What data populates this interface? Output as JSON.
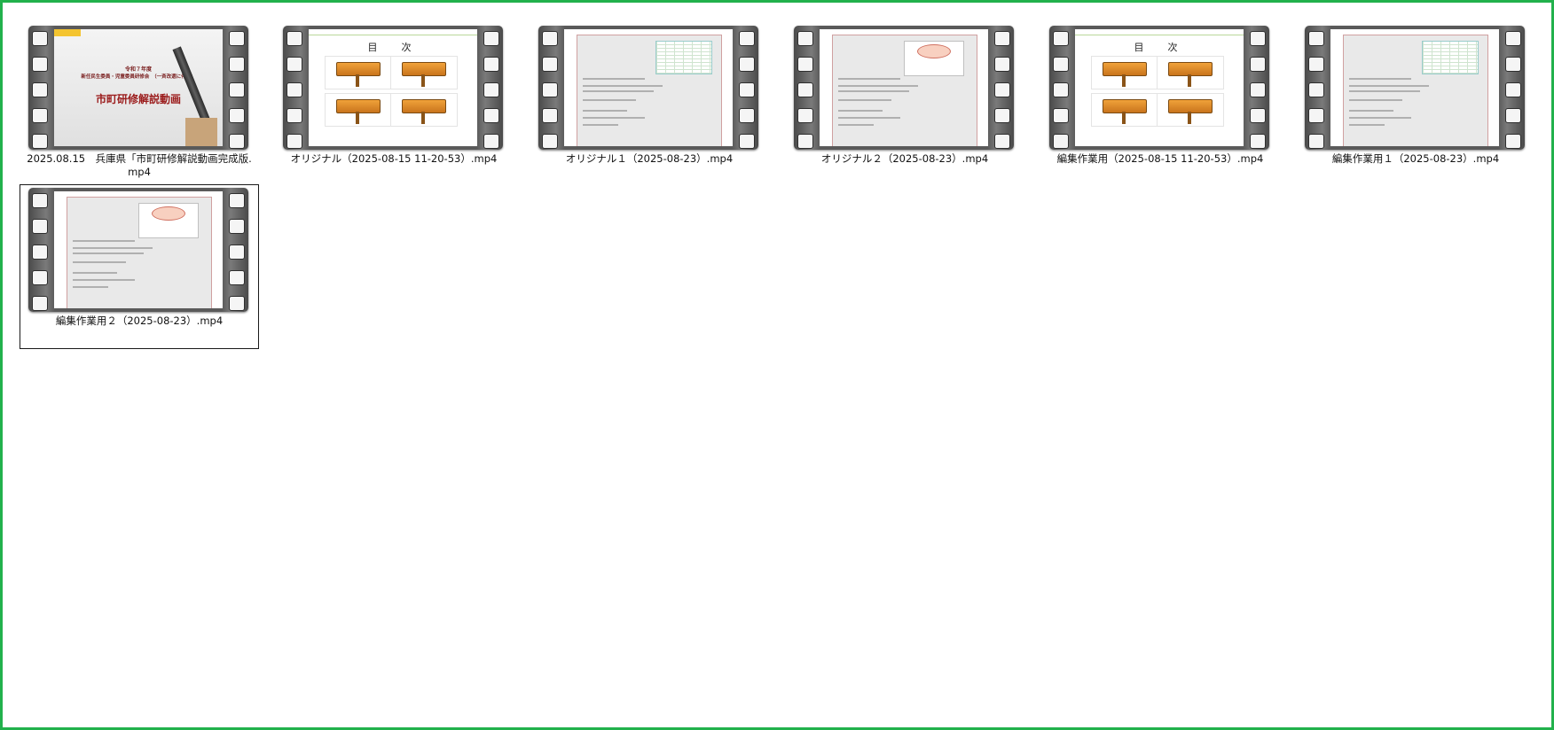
{
  "files": [
    {
      "name": "2025.08.15　兵庫県「市町研修解説動画完成版.mp4",
      "thumb": "title",
      "selected": false
    },
    {
      "name": "オリジナル（2025-08-15 11-20-53）.mp4",
      "thumb": "toc",
      "selected": false
    },
    {
      "name": "オリジナル１（2025-08-23）.mp4",
      "thumb": "doc-table",
      "selected": false
    },
    {
      "name": "オリジナル２（2025-08-23）.mp4",
      "thumb": "doc-box",
      "selected": false
    },
    {
      "name": "編集作業用（2025-08-15 11-20-53）.mp4",
      "thumb": "toc",
      "selected": false
    },
    {
      "name": "編集作業用１（2025-08-23）.mp4",
      "thumb": "doc-table",
      "selected": false
    },
    {
      "name": "編集作業用２（2025-08-23）.mp4",
      "thumb": "doc-box",
      "selected": true
    }
  ],
  "thumb_title": {
    "line1": "令和７年度",
    "line2": "新任民生委員・児童委員研修会　（一斉改選に伴う）",
    "main": "市町研修解説動画"
  },
  "thumb_toc": {
    "title": "目　次"
  },
  "colors": {
    "window_border": "#22b14c",
    "selection_border": "#1a1a1a"
  }
}
